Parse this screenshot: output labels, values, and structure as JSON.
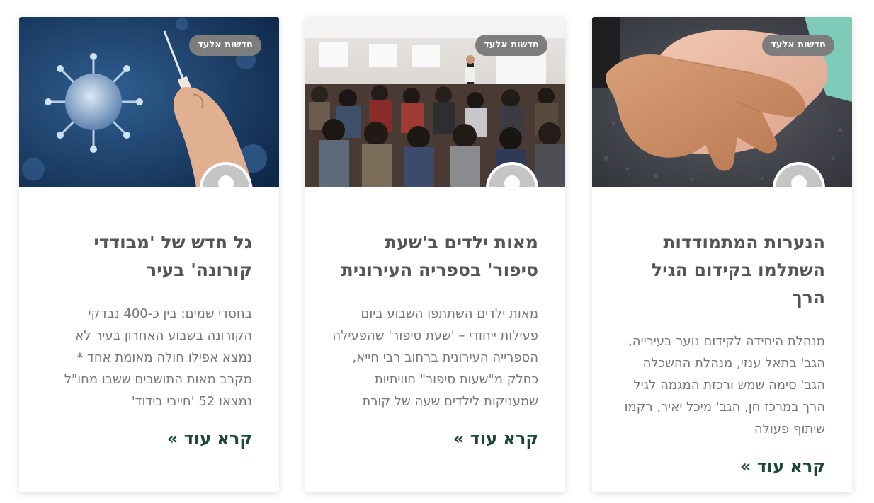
{
  "cards": [
    {
      "badge": "חדשות אלעד",
      "title": "הנערות המתמודדות השתלמו בקידום הגיל הרך",
      "excerpt": "מנהלת היחידה לקידום נוער בעירייה, הגב' בתאל ענזי, מנהלת ההשכלה הגב' סימה שמש ורכזת המגמה לגיל הרך במרכז חן, הגב' מיכל יאיר, רקמו שיתוף פעולה",
      "read_more": "קרא עוד »"
    },
    {
      "badge": "חדשות אלעד",
      "title": "מאות ילדים ב'שעת סיפור' בספריה העירונית",
      "excerpt": "מאות ילדים השתתפו השבוע ביום פעילות ייחודי – 'שעת סיפור' שהפעילה הספרייה העירונית ברחוב רבי חייא, כחלק מ\"שעות סיפור\" חוויתיות שמעניקות לילדים שעה של קורת",
      "read_more": "קרא עוד »"
    },
    {
      "badge": "חדשות אלעד",
      "title": "גל חדש של 'מבודדי קורונה' בעיר",
      "excerpt": "בחסדי שמים: בין כ-400 נבדקי הקורונה בשבוע האחרון בעיר לא נמצא אפילו חולה מאומת אחד * מקרב מאות התושבים ששבו מחו\"ל נמצאו 52 'חייבי בידוד'",
      "read_more": "קרא עוד »"
    }
  ],
  "colors": {
    "badge_bg": "#7d7d7d",
    "title": "#555555",
    "excerpt": "#777777",
    "read_more": "#1e4636"
  }
}
